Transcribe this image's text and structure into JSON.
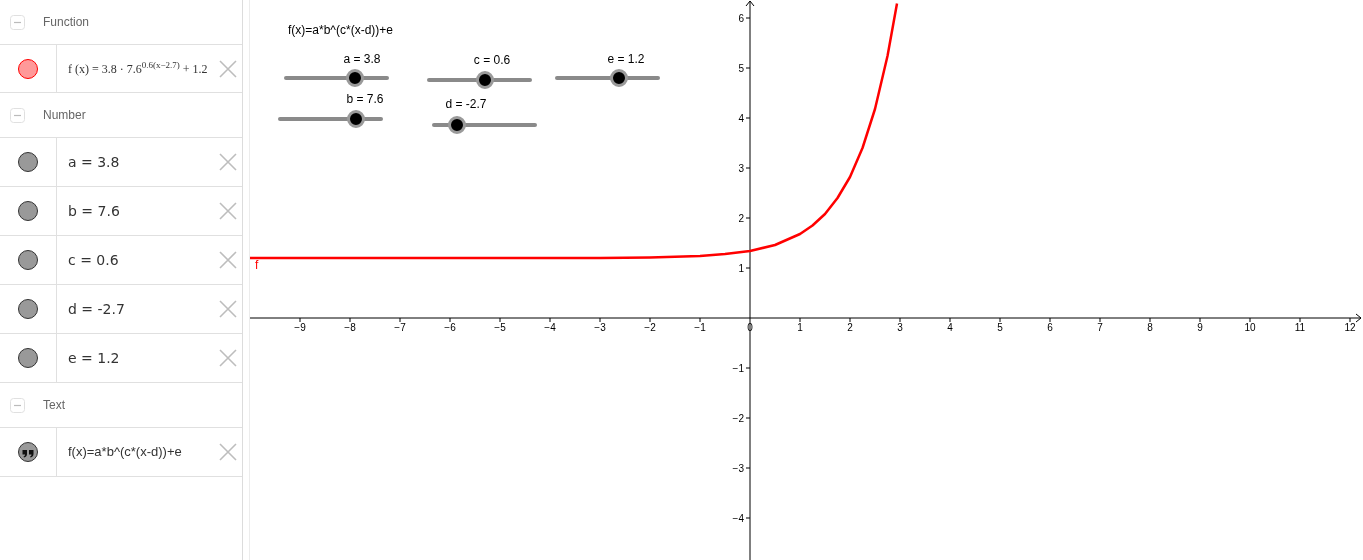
{
  "algebra": {
    "groups": [
      {
        "title": "Function",
        "items": [
          {
            "kind": "function",
            "text": "f (x)  =  3.8 · 7.6$^{0.6(x−2.7)}$ + 1.2",
            "color": "#ff0000"
          }
        ]
      },
      {
        "title": "Number",
        "items": [
          {
            "kind": "number",
            "text": "a = 3.8",
            "color": "#999999"
          },
          {
            "kind": "number",
            "text": "b = 7.6",
            "color": "#999999"
          },
          {
            "kind": "number",
            "text": "c = 0.6",
            "color": "#999999"
          },
          {
            "kind": "number",
            "text": "d = -2.7",
            "color": "#999999"
          },
          {
            "kind": "number",
            "text": "e = 1.2",
            "color": "#999999"
          }
        ]
      },
      {
        "title": "Text",
        "items": [
          {
            "kind": "text",
            "text": "f(x)=a*b^(c*(x-d))+e",
            "color": "#999999"
          }
        ]
      }
    ]
  },
  "graphics": {
    "text": "f(x)=a*b^(c*(x-d))+e",
    "sliders": [
      {
        "label": "a = 3.8",
        "level": 0.68
      },
      {
        "label": "c = 0.6",
        "level": 0.55
      },
      {
        "label": "e = 1.2",
        "level": 0.61
      },
      {
        "label": "b = 7.6",
        "level": 0.74
      },
      {
        "label": "d = -2.7",
        "level": 0.24
      }
    ],
    "chart_data": {
      "type": "line",
      "x": [
        -10,
        -8,
        -6,
        -4,
        -3,
        -2,
        -1,
        -0.5,
        0,
        0.5,
        1,
        1.25,
        1.5,
        1.75,
        2,
        2.25,
        2.5,
        2.75,
        2.94
      ],
      "series": [
        {
          "name": "f",
          "color": "#ff0000",
          "values": [
            1.2,
            1.2,
            1.2,
            1.2,
            1.2,
            1.21,
            1.24,
            1.28,
            1.34,
            1.46,
            1.68,
            1.85,
            2.08,
            2.4,
            2.82,
            3.4,
            4.18,
            5.24,
            6.29
          ]
        }
      ],
      "xlim": [
        -10,
        12.26
      ],
      "ylim": [
        -4.84,
        6.36
      ],
      "xticks": [
        {
          "value": -9,
          "label": "−9"
        },
        {
          "value": -8,
          "label": "−8"
        },
        {
          "value": -7,
          "label": "−7"
        },
        {
          "value": -6,
          "label": "−6"
        },
        {
          "value": -5,
          "label": "−5"
        },
        {
          "value": -4,
          "label": "−4"
        },
        {
          "value": -3,
          "label": "−3"
        },
        {
          "value": -2,
          "label": "−2"
        },
        {
          "value": -1,
          "label": "−1"
        },
        {
          "value": 0,
          "label": "0"
        },
        1,
        2,
        3,
        4,
        5,
        6,
        7,
        8,
        9,
        10,
        11,
        12
      ],
      "yticks": [
        {
          "value": -4,
          "label": "−4"
        },
        {
          "value": -3,
          "label": "−3"
        },
        {
          "value": -2,
          "label": "−2"
        },
        {
          "value": -1,
          "label": "−1"
        },
        1,
        2,
        3,
        4,
        5,
        6
      ]
    }
  }
}
